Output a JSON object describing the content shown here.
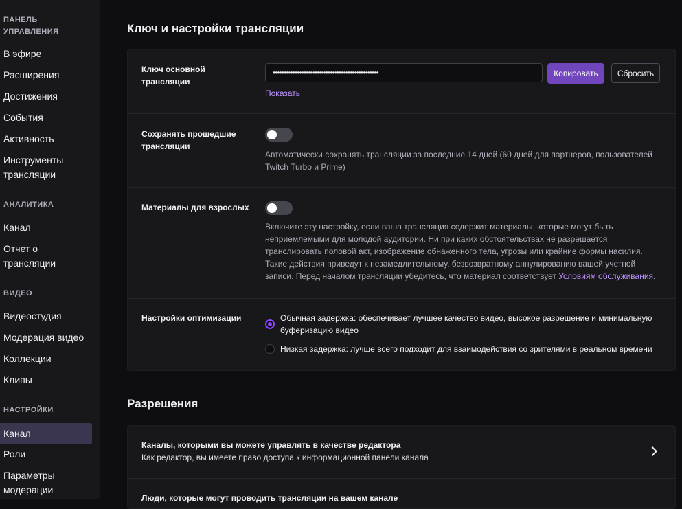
{
  "sidebar": {
    "panel_section": "ПАНЕЛЬ УПРАВЛЕНИЯ",
    "panel_items": [
      "В эфире",
      "Расширения",
      "Достижения",
      "События",
      "Активность",
      "Инструменты трансляции"
    ],
    "analytics_section": "АНАЛИТИКА",
    "analytics_items": [
      "Канал",
      "Отчет о трансляции"
    ],
    "video_section": "ВИДЕО",
    "video_items": [
      "Видеостудия",
      "Модерация видео",
      "Коллекции",
      "Клипы"
    ],
    "settings_section": "НАСТРОЙКИ",
    "settings_items": [
      "Канал",
      "Роли",
      "Параметры модерации"
    ]
  },
  "stream": {
    "heading": "Ключ и настройки трансляции",
    "key_label": "Ключ основной трансляции",
    "key_value": "••••••••••••••••••••••••••••••••••••••••••••••••",
    "copy_label": "Копировать",
    "reset_label": "Сбросить",
    "show_label": "Показать",
    "save_label": "Сохранять прошедшие трансляции",
    "save_desc": "Автоматически сохранять трансляции за последние 14 дней (60 дней для партнеров, пользователей Twitch Turbo и Prime)",
    "mature_label": "Материалы для взрослых",
    "mature_desc": "Включите эту настройку, если ваша трансляция содержит материалы, которые могут быть неприемлемыми для молодой аудитории. Ни при каких обстоятельствах не разрешается транслировать половой акт, изображение обнаженного тела, угрозы или крайние формы насилия. Такие действия приведут к незамедлительному, безвозвратному аннулированию вашей учетной записи. Перед началом трансляции убедитесь, что материал соответствует ",
    "mature_link": "Условиям обслуживания",
    "mature_end": ".",
    "opt_label": "Настройки оптимизации",
    "opt_normal": "Обычная задержка: обеспечивает лучшее качество видео, высокое разрешение и минимальную буферизацию видео",
    "opt_low": "Низкая задержка: лучше всего подходит для взаимодействия со зрителями в реальном времени"
  },
  "permissions": {
    "heading": "Разрешения",
    "editor_title": "Каналы, которыми вы можете управлять в качестве редактора",
    "editor_sub": "Как редактор, вы имеете право доступа к информационной панели канала",
    "stream_title": "Люди, которые могут проводить трансляции на вашем канале"
  },
  "colors": {
    "accent": "#9147ff",
    "button": "#7145bb",
    "link": "#bf94ff",
    "active_nav": "#3a3650"
  }
}
